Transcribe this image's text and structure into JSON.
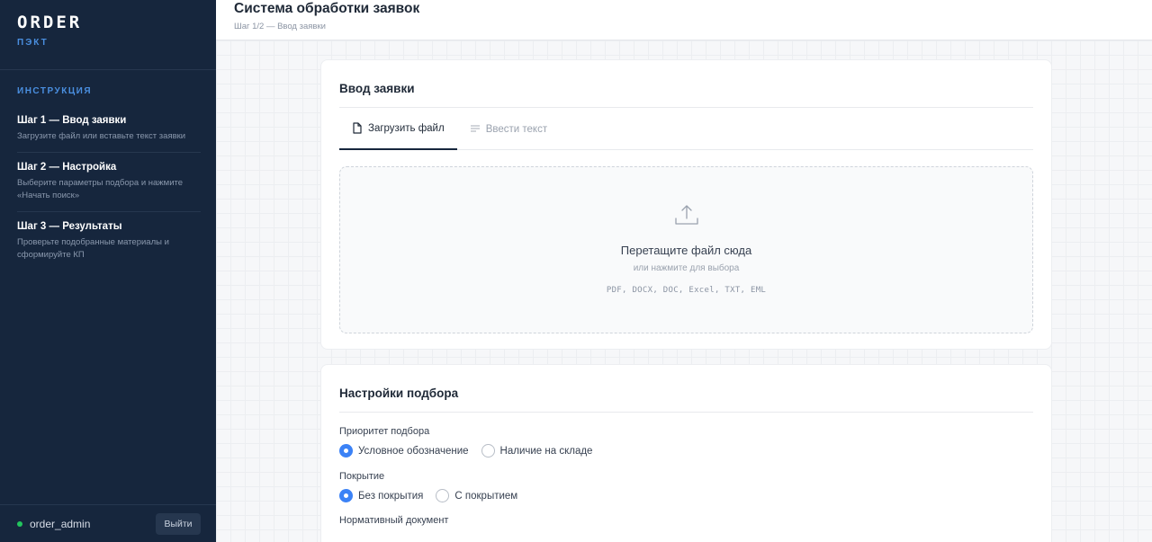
{
  "brand": {
    "name": "ORDER",
    "subtitle": "ПЭКТ"
  },
  "sidebar": {
    "instructions_title": "ИНСТРУКЦИЯ",
    "steps": [
      {
        "title": "Шаг 1 — Ввод заявки",
        "description": "Загрузите файл или вставьте текст заявки"
      },
      {
        "title": "Шаг 2 — Настройка",
        "description": "Выберите параметры подбора и нажмите «Начать поиск»"
      },
      {
        "title": "Шаг 3 — Результаты",
        "description": "Проверьте подобранные материалы и сформируйте КП"
      }
    ],
    "user": {
      "name": "order_admin",
      "status_color": "#22c55e"
    },
    "logout_label": "Выйти"
  },
  "header": {
    "title": "Система обработки заявок",
    "breadcrumb": "Шаг 1/2 — Ввод заявки"
  },
  "input_card": {
    "title": "Ввод заявки",
    "tabs": [
      {
        "label": "Загрузить файл",
        "icon": "file-icon",
        "active": true
      },
      {
        "label": "Ввести текст",
        "icon": "text-lines-icon",
        "active": false
      }
    ],
    "dropzone": {
      "icon": "upload-icon",
      "title": "Перетащите файл сюда",
      "subtitle": "или нажмите для выбора",
      "formats": "PDF, DOCX, DOC, Excel, TXT, EML"
    }
  },
  "settings_card": {
    "title": "Настройки подбора",
    "priority": {
      "label": "Приоритет подбора",
      "options": [
        {
          "label": "Условное обозначение",
          "checked": true
        },
        {
          "label": "Наличие на складе",
          "checked": false
        }
      ]
    },
    "coating": {
      "label": "Покрытие",
      "options": [
        {
          "label": "Без покрытия",
          "checked": true
        },
        {
          "label": "С покрытием",
          "checked": false
        }
      ]
    },
    "normative_label": "Нормативный документ"
  },
  "colors": {
    "sidebar_bg": "#16263d",
    "accent": "#3b82f6",
    "brand_accent": "#4a8fe0"
  }
}
